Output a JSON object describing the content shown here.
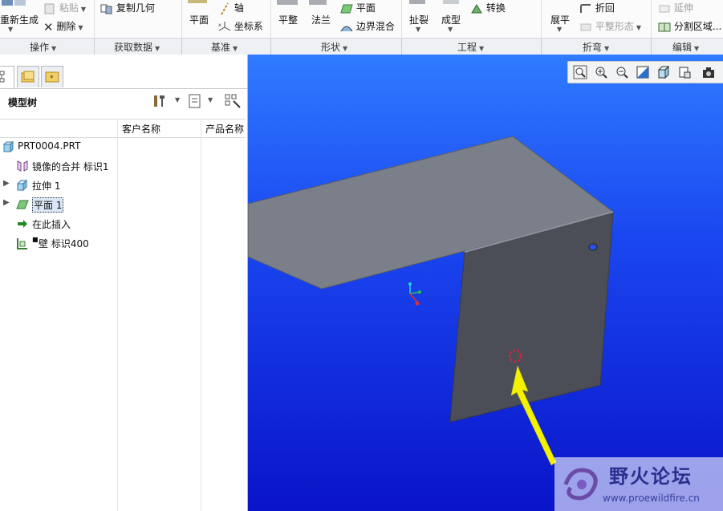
{
  "ribbon": {
    "regen": "重新生成",
    "paste": "粘贴",
    "delete": "删除",
    "copy_geometry": "复制几何",
    "plane": "平面",
    "axis": "轴",
    "coord_system": "坐标系",
    "flat": "平整",
    "flange": "法兰",
    "flat_plane": "平面",
    "boundary_blend": "边界混合",
    "rip": "扯裂",
    "form": "成型",
    "convert": "转换",
    "unbend": "展平",
    "bend_back": "折回",
    "flat_pattern": "平整形态",
    "extend": "延伸",
    "split_area": "分割区域..."
  },
  "groups": {
    "operations": "操作",
    "get_data": "获取数据",
    "datum": "基准",
    "shapes": "形状",
    "engineering": "工程",
    "bends": "折弯",
    "editing": "编辑"
  },
  "panel": {
    "title": "模型树",
    "col_customer": "客户名称",
    "col_product": "产品名称"
  },
  "tree": [
    {
      "label": "PRT0004.PRT",
      "icon": "part-icon"
    },
    {
      "label": "镜像的合并 标识1",
      "icon": "mirror-merge-icon"
    },
    {
      "label": "拉伸 1",
      "icon": "extrude-icon"
    },
    {
      "label": "平面 1",
      "icon": "flat-wall-icon"
    },
    {
      "label": "在此插入",
      "icon": "insert-here-icon"
    },
    {
      "label": "壁 标识400",
      "icon": "wall-icon"
    }
  ],
  "watermark": {
    "title": "野火论坛",
    "url": "www.proewildfire.cn"
  },
  "colors": {
    "accent_arrow": "#f3f000",
    "highlight_circle": "#e0203a",
    "viewport_top": "#2f7bff",
    "viewport_bottom": "#0a14c8"
  }
}
